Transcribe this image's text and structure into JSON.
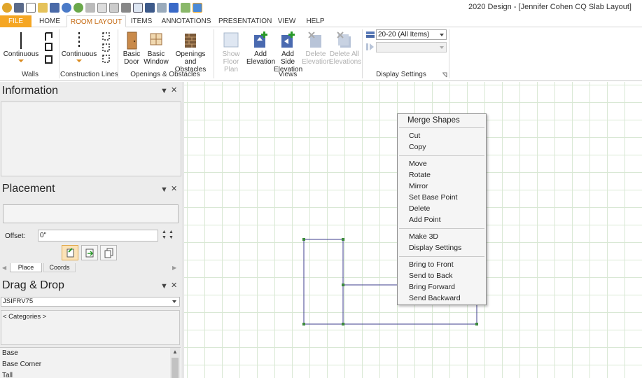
{
  "window": {
    "title": "2020 Design - [Jennifer Cohen CQ Slab Layout]"
  },
  "quick_access": [
    "app-icon",
    "lock-icon",
    "new-icon",
    "open-icon",
    "save-icon",
    "undo-icon",
    "redo-icon",
    "cut-icon",
    "copy-icon",
    "paste-icon",
    "delete-icon",
    "table-icon",
    "fit-icon",
    "image-icon",
    "cube-icon",
    "floorplan-icon",
    "render-icon"
  ],
  "tabs": [
    "FILE",
    "HOME",
    "ROOM LAYOUT",
    "ITEMS",
    "ANNOTATIONS",
    "PRESENTATION",
    "VIEW",
    "HELP"
  ],
  "active_tab": "ROOM LAYOUT",
  "ribbon": {
    "walls": {
      "continuous": "Continuous",
      "label": "Walls"
    },
    "construction": {
      "continuous": "Continuous",
      "label": "Construction Lines"
    },
    "openings": {
      "basic_door": [
        "Basic",
        "Door"
      ],
      "basic_window": [
        "Basic",
        "Window"
      ],
      "openings": [
        "Openings",
        "and Obstacles"
      ],
      "label": "Openings & Obstacles"
    },
    "views": {
      "show_floor_plan": [
        "Show",
        "Floor Plan"
      ],
      "add_elevation": [
        "Add",
        "Elevation"
      ],
      "add_side_elevation": [
        "Add Side",
        "Elevation"
      ],
      "delete_elevation": [
        "Delete",
        "Elevation"
      ],
      "delete_all_elevations": [
        "Delete All",
        "Elevations"
      ],
      "label": "Views"
    },
    "display": {
      "combo_value": "20-20 (All Items)",
      "label": "Display Settings"
    }
  },
  "information": {
    "title": "Information"
  },
  "placement": {
    "title": "Placement",
    "offset_label": "Offset:",
    "offset_value": "0\"",
    "tabs": [
      "Place",
      "Coords"
    ]
  },
  "dragdrop": {
    "title": "Drag & Drop",
    "catalog": "JSIFRV75",
    "categories_label": "< Categories >",
    "items": [
      "Base",
      "Base Corner",
      "Tall"
    ]
  },
  "context_menu": {
    "header": "Merge Shapes",
    "group1": [
      "Cut",
      "Copy"
    ],
    "group2": [
      "Move",
      "Rotate",
      "Mirror",
      "Set Base Point",
      "Delete",
      "Add Point"
    ],
    "group3": [
      "Make 3D",
      "Display Settings"
    ],
    "group4": [
      "Bring to Front",
      "Send to Back",
      "Bring Forward",
      "Send Backward"
    ]
  },
  "colors": {
    "file_tab": "#f5a623",
    "accent": "#c56a12",
    "grid": "#d9e8d4",
    "shape_outline": "#3c3c8c",
    "handle": "#3d8b3d"
  }
}
